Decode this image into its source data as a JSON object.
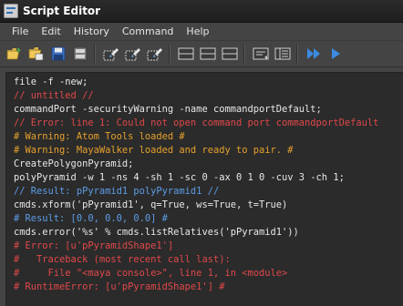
{
  "window": {
    "title": "Script Editor"
  },
  "menu": [
    "File",
    "Edit",
    "History",
    "Command",
    "Help"
  ],
  "toolbar": {
    "buttons": [
      {
        "name": "open-script-icon"
      },
      {
        "name": "source-script-icon"
      },
      {
        "name": "save-script-icon"
      },
      {
        "name": "save-script-to-shelf-icon"
      },
      {
        "name": "clear-history-icon"
      },
      {
        "name": "clear-input-icon"
      },
      {
        "name": "clear-all-icon"
      },
      {
        "name": "show-history-only-icon"
      },
      {
        "name": "show-input-only-icon"
      },
      {
        "name": "show-both-icon"
      },
      {
        "name": "echo-all-commands-icon"
      },
      {
        "name": "show-line-numbers-icon"
      },
      {
        "name": "execute-all-icon"
      },
      {
        "name": "execute-icon"
      }
    ]
  },
  "colors": {
    "command": "#e8e8e8",
    "error": "#e0484a",
    "warning": "#e6a12c",
    "result": "#5c9ce6"
  },
  "output_lines": [
    {
      "text": "file -f -new;",
      "type": "command"
    },
    {
      "text": "// untitled //",
      "type": "error"
    },
    {
      "text": "commandPort -securityWarning -name commandportDefault;",
      "type": "command"
    },
    {
      "text": "// Error: line 1: Could not open command port commandportDefault",
      "type": "error"
    },
    {
      "text": "# Warning: Atom Tools loaded #",
      "type": "warning"
    },
    {
      "text": "# Warning: MayaWalker loaded and ready to pair. #",
      "type": "warning"
    },
    {
      "text": "CreatePolygonPyramid;",
      "type": "command"
    },
    {
      "text": "polyPyramid -w 1 -ns 4 -sh 1 -sc 0 -ax 0 1 0 -cuv 3 -ch 1;",
      "type": "command"
    },
    {
      "text": "// Result: pPyramid1 polyPyramid1 //",
      "type": "result"
    },
    {
      "text": "cmds.xform('pPyramid1', q=True, ws=True, t=True)",
      "type": "command"
    },
    {
      "text": "# Result: [0.0, 0.0, 0.0] #",
      "type": "result"
    },
    {
      "text": "cmds.error('%s' % cmds.listRelatives('pPyramid1'))",
      "type": "command"
    },
    {
      "text": "# Error: [u'pPyramidShape1']",
      "type": "error"
    },
    {
      "text": "#   Traceback (most recent call last):",
      "type": "error"
    },
    {
      "text": "#     File \"<maya console>\", line 1, in <module>",
      "type": "error"
    },
    {
      "text": "# RuntimeError: [u'pPyramidShape1'] #",
      "type": "error"
    }
  ]
}
